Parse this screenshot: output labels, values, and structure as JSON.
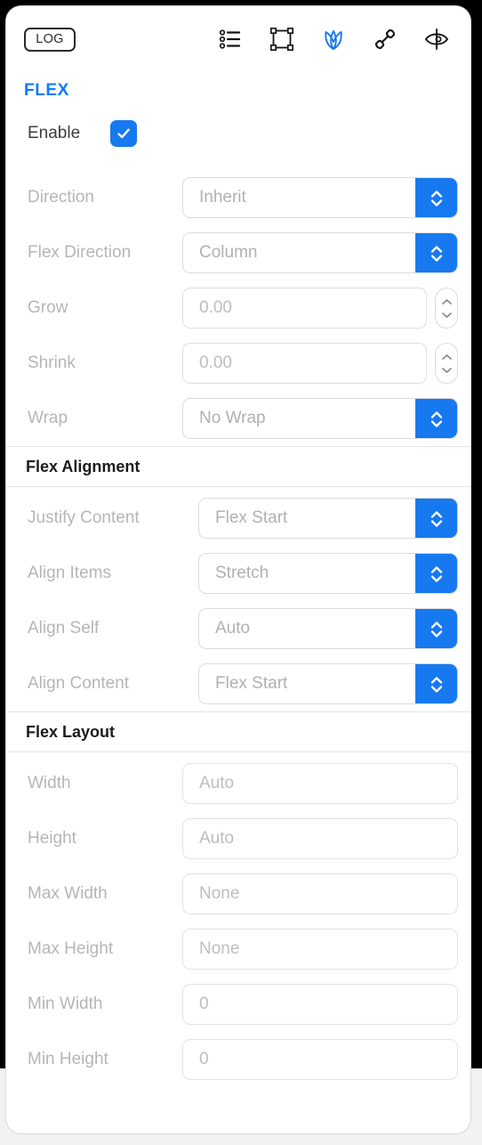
{
  "toolbar": {
    "log_label": "LOG",
    "icons": [
      {
        "name": "list-icon",
        "active": false
      },
      {
        "name": "selection-frame-icon",
        "active": false
      },
      {
        "name": "lotus-icon",
        "active": true
      },
      {
        "name": "link-icon",
        "active": false
      },
      {
        "name": "eye-visibility-icon",
        "active": false
      }
    ]
  },
  "panel": {
    "title": "FLEX",
    "accent_color": "#0a7cff",
    "stepper_color": "#1779f0"
  },
  "enable_row": {
    "label": "Enable",
    "checked": true,
    "check_glyph": "✓"
  },
  "flex_section": {
    "rows": [
      {
        "label": "Direction",
        "value": "Inherit",
        "control": "select"
      },
      {
        "label": "Flex Direction",
        "value": "Column",
        "control": "select"
      },
      {
        "label": "Grow",
        "value": "0.00",
        "control": "number"
      },
      {
        "label": "Shrink",
        "value": "0.00",
        "control": "number"
      },
      {
        "label": "Wrap",
        "value": "No Wrap",
        "control": "select"
      }
    ]
  },
  "alignment_section": {
    "header": "Flex Alignment",
    "rows": [
      {
        "label": "Justify Content",
        "value": "Flex Start",
        "control": "select"
      },
      {
        "label": "Align Items",
        "value": "Stretch",
        "control": "select"
      },
      {
        "label": "Align Self",
        "value": "Auto",
        "control": "select"
      },
      {
        "label": "Align Content",
        "value": "Flex Start",
        "control": "select"
      }
    ]
  },
  "layout_section": {
    "header": "Flex Layout",
    "rows": [
      {
        "label": "Width",
        "value": "Auto",
        "control": "text"
      },
      {
        "label": "Height",
        "value": "Auto",
        "control": "text"
      },
      {
        "label": "Max Width",
        "value": "None",
        "control": "text"
      },
      {
        "label": "Max Height",
        "value": "None",
        "control": "text"
      },
      {
        "label": "Min Width",
        "value": "0",
        "control": "text"
      },
      {
        "label": "Min Height",
        "value": "0",
        "control": "text"
      }
    ]
  }
}
